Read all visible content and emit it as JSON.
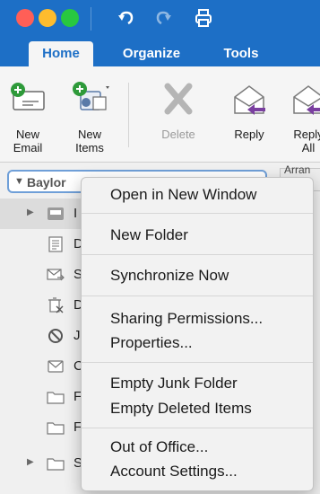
{
  "titlebar": {
    "icons": [
      "undo-icon",
      "redo-icon",
      "print-icon"
    ]
  },
  "tabs": [
    {
      "label": "Home",
      "active": true
    },
    {
      "label": "Organize",
      "active": false
    },
    {
      "label": "Tools",
      "active": false
    }
  ],
  "ribbon": {
    "new_email": {
      "line1": "New",
      "line2": "Email"
    },
    "new_items": {
      "line1": "New",
      "line2": "Items"
    },
    "delete": {
      "label": "Delete",
      "disabled": true
    },
    "reply": {
      "label": "Reply"
    },
    "reply_all": {
      "line1": "Reply",
      "line2": "All"
    }
  },
  "folder_pane": {
    "account_name": "Baylor",
    "arrange_label": "Arran",
    "folders": [
      {
        "letter": "I",
        "icon": "inbox-icon",
        "disclosure": true,
        "selected": true
      },
      {
        "letter": "D",
        "icon": "drafts-icon",
        "disclosure": false,
        "selected": false
      },
      {
        "letter": "S",
        "icon": "sent-icon",
        "disclosure": false,
        "selected": false
      },
      {
        "letter": "D",
        "icon": "deleted-items-icon",
        "disclosure": false,
        "selected": false
      },
      {
        "letter": "J",
        "icon": "junk-icon",
        "disclosure": false,
        "selected": false
      },
      {
        "letter": "C",
        "icon": "outbox-icon",
        "disclosure": false,
        "selected": false
      },
      {
        "letter": "F",
        "icon": "folder-icon",
        "disclosure": false,
        "selected": false
      },
      {
        "letter": "F",
        "icon": "folder-icon",
        "disclosure": false,
        "selected": false
      },
      {
        "letter": "S",
        "icon": "folder-icon",
        "disclosure": true,
        "selected": false
      }
    ]
  },
  "context_menu": {
    "open_new_window": "Open in New Window",
    "new_folder": "New Folder",
    "synchronize_now": "Synchronize Now",
    "sharing_permissions": "Sharing Permissions...",
    "properties": "Properties...",
    "empty_junk": "Empty Junk Folder",
    "empty_deleted": "Empty Deleted Items",
    "out_of_office": "Out of Office...",
    "account_settings": "Account Settings..."
  },
  "colors": {
    "accent": "#1d6fc6",
    "selected_row": "#dcdcdc",
    "reply_arrow": "#7a3fa0",
    "new_badge": "#2e9a3a"
  }
}
